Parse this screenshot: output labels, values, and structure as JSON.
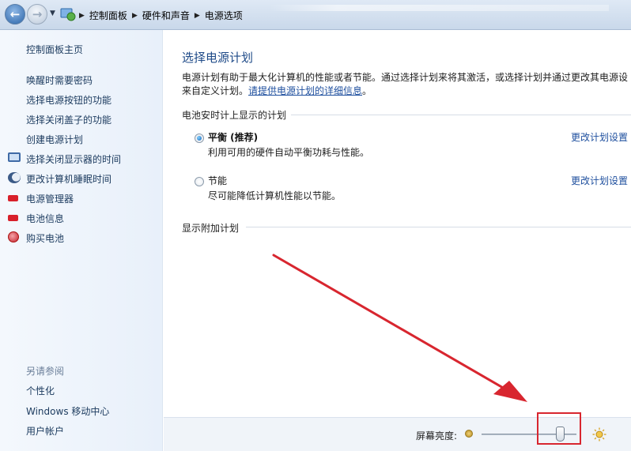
{
  "breadcrumb": {
    "items": [
      "控制面板",
      "硬件和声音",
      "电源选项"
    ]
  },
  "sidebar": {
    "home": "控制面板主页",
    "links": [
      {
        "label": "唤醒时需要密码",
        "icon": ""
      },
      {
        "label": "选择电源按钮的功能",
        "icon": ""
      },
      {
        "label": "选择关闭盖子的功能",
        "icon": ""
      },
      {
        "label": "创建电源计划",
        "icon": ""
      },
      {
        "label": "选择关闭显示器的时间",
        "icon": "monitor-icon"
      },
      {
        "label": "更改计算机睡眠时间",
        "icon": "moon-icon"
      },
      {
        "label": "电源管理器",
        "icon": "battery-red-icon"
      },
      {
        "label": "电池信息",
        "icon": "battery-red-icon"
      },
      {
        "label": "购买电池",
        "icon": "globe-icon"
      }
    ],
    "see_also": "另请参阅",
    "see_also_links": [
      "个性化",
      "Windows 移动中心",
      "用户帐户"
    ]
  },
  "main": {
    "title": "选择电源计划",
    "intro_line1": "电源计划有助于最大化计算机的性能或者节能。通过选择计划来将其激活，或选择计划并通过更改其电源设",
    "intro_line2_prefix": "来自定义计划。",
    "intro_link": "请提供电源计划的详细信息",
    "intro_line2_suffix": "。",
    "battery_group_title": "电池安时计上显示的计划",
    "plans": [
      {
        "name": "平衡 (推荐)",
        "desc": "利用可用的硬件自动平衡功耗与性能。",
        "link": "更改计划设置",
        "selected": true
      },
      {
        "name": "节能",
        "desc": "尽可能降低计算机性能以节能。",
        "link": "更改计划设置",
        "selected": false
      }
    ],
    "extra_group_title": "显示附加计划"
  },
  "bottom": {
    "brightness_label": "屏幕亮度:",
    "brightness_level": 0.83
  },
  "colors": {
    "annotation": "#d8262f",
    "link": "#1e4f9e",
    "title": "#1e4a88"
  }
}
